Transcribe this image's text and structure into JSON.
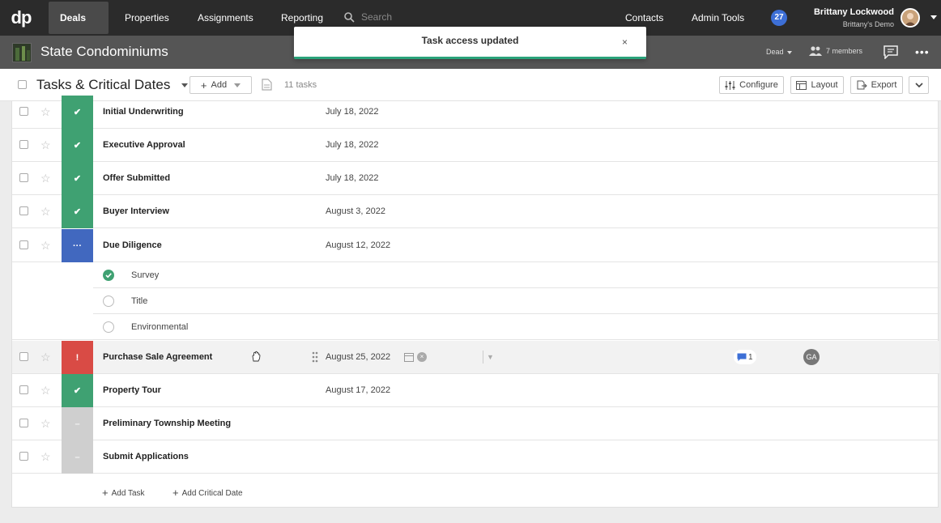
{
  "topnav": {
    "logo": "dp",
    "items": {
      "deals": "Deals",
      "properties": "Properties",
      "assignments": "Assignments",
      "reporting": "Reporting",
      "contacts": "Contacts",
      "admin_tools": "Admin Tools"
    },
    "search_placeholder": "Search",
    "notification_count": "27",
    "user_name": "Brittany Lockwood",
    "user_org": "Brittany's Demo"
  },
  "deal": {
    "name": "State Condominiums",
    "status": "Dead",
    "members": "7 members"
  },
  "toast": {
    "message": "Task access updated",
    "close": "×"
  },
  "toolbar": {
    "title": "Tasks & Critical Dates",
    "add_label": "Add",
    "task_count": "11 tasks",
    "configure": "Configure",
    "layout": "Layout",
    "export": "Export"
  },
  "tasks": [
    {
      "name": "Initial Underwriting",
      "date": "July 18, 2022",
      "status": "done",
      "status_glyph": "✔"
    },
    {
      "name": "Executive Approval",
      "date": "July 18, 2022",
      "status": "done",
      "status_glyph": "✔"
    },
    {
      "name": "Offer Submitted",
      "date": "July 18, 2022",
      "status": "done",
      "status_glyph": "✔"
    },
    {
      "name": "Buyer Interview",
      "date": "August 3, 2022",
      "status": "done",
      "status_glyph": "✔"
    },
    {
      "name": "Due Diligence",
      "date": "August 12, 2022",
      "status": "in-progress",
      "status_glyph": "···"
    },
    {
      "name": "Purchase Sale Agreement",
      "date": "August 25, 2022",
      "status": "alert",
      "status_glyph": "!",
      "comments": "1",
      "assignee": "GA"
    },
    {
      "name": "Property Tour",
      "date": "August 17, 2022",
      "status": "done",
      "status_glyph": "✔"
    },
    {
      "name": "Preliminary Township Meeting",
      "date": "",
      "status": "none",
      "status_glyph": "–"
    },
    {
      "name": "Submit Applications",
      "date": "",
      "status": "none",
      "status_glyph": "–"
    }
  ],
  "subtasks": [
    {
      "label": "Survey",
      "done": true
    },
    {
      "label": "Title",
      "done": false
    },
    {
      "label": "Environmental",
      "done": false
    }
  ],
  "footer": {
    "add_task": "Add Task",
    "add_critical_date": "Add Critical Date"
  },
  "colors": {
    "done": "#3fa172",
    "in_progress": "#4168bf",
    "alert": "#d94b45",
    "none": "#cfcfcf",
    "notification": "#3d6fd6"
  }
}
